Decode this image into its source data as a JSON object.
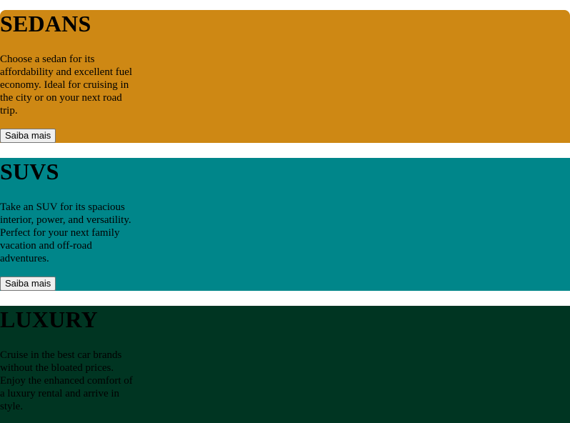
{
  "cards": [
    {
      "title": "SEDANS",
      "description": "Choose a sedan for its affordability and excellent fuel economy. Ideal for cruising in the city or on your next road trip.",
      "button_label": "Saiba mais",
      "background": "#CE8814"
    },
    {
      "title": "SUVS",
      "description": "Take an SUV for its spacious interior, power, and versatility. Perfect for your next family vacation and off-road adventures.",
      "button_label": "Saiba mais",
      "background": "#00868A"
    },
    {
      "title": "LUXURY",
      "description": "Cruise in the best car brands without the bloated prices. Enjoy the enhanced comfort of a luxury rental and arrive in style.",
      "background": "#003522"
    }
  ]
}
